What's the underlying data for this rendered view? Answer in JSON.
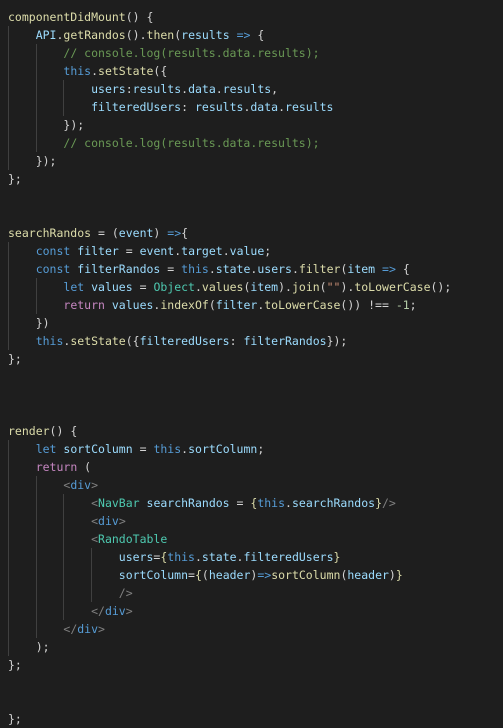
{
  "editor": {
    "language": "javascript-react",
    "theme": "dark-plus",
    "background_color": "#1e1e1e",
    "default_text_color": "#d4d4d4",
    "indent_guide_color": "#404040",
    "font_size_px": 11.5,
    "line_height_px": 18,
    "token_colors": {
      "function": "#dcdcaa",
      "variable": "#9cdcfe",
      "keyword": "#569cd6",
      "control": "#c586c0",
      "class": "#4ec9b0",
      "comment": "#6a9955",
      "number": "#b5cea8",
      "string": "#ce9178",
      "punctuation": "#808080",
      "plain": "#d4d4d4"
    }
  },
  "code": {
    "plain_text": "componentDidMount() {\n    API.getRandos().then(results => {\n        // console.log(results.data.results);\n        this.setState({\n            users:results.data.results,\n            filteredUsers: results.data.results\n        });\n        // console.log(results.data.results);\n    });\n};\n\n\nsearchRandos = (event) =>{\n    const filter = event.target.value;\n    const filterRandos = this.state.users.filter(item => {\n        let values = Object.values(item).join(\"\").toLowerCase();\n        return values.indexOf(filter.toLowerCase()) !== -1;\n    })\n    this.setState({filteredUsers: filterRandos});\n};\n\n\n\nrender() {\n    let sortColumn = this.sortColumn;\n    return (\n        <div>\n            <NavBar searchRandos = {this.searchRandos}/>\n            <div>\n            <RandoTable\n                users={this.state.filteredUsers}\n                sortColumn={(header)=>sortColumn(header)}\n                />\n            </div>\n        </div>\n    );\n};\n\n\n};",
    "lines": [
      {
        "indent": 0,
        "guides": [],
        "tokens": [
          {
            "c": "t-func",
            "t": "componentDidMount"
          },
          {
            "c": "t-brace",
            "t": "() {"
          }
        ]
      },
      {
        "indent": 1,
        "guides": [
          0
        ],
        "tokens": [
          {
            "c": "t-var",
            "t": "API"
          },
          {
            "c": "t-brace",
            "t": "."
          },
          {
            "c": "t-func",
            "t": "getRandos"
          },
          {
            "c": "t-brace",
            "t": "()."
          },
          {
            "c": "t-func",
            "t": "then"
          },
          {
            "c": "t-brace",
            "t": "("
          },
          {
            "c": "t-var",
            "t": "results"
          },
          {
            "c": "t-brace",
            "t": " "
          },
          {
            "c": "t-key",
            "t": "=>"
          },
          {
            "c": "t-brace",
            "t": " {"
          }
        ]
      },
      {
        "indent": 2,
        "guides": [
          0,
          1
        ],
        "tokens": [
          {
            "c": "t-comment",
            "t": "// console.log(results.data.results);"
          }
        ]
      },
      {
        "indent": 2,
        "guides": [
          0,
          1
        ],
        "tokens": [
          {
            "c": "t-key",
            "t": "this"
          },
          {
            "c": "t-brace",
            "t": "."
          },
          {
            "c": "t-func",
            "t": "setState"
          },
          {
            "c": "t-brace",
            "t": "({"
          }
        ]
      },
      {
        "indent": 3,
        "guides": [
          0,
          1,
          2
        ],
        "tokens": [
          {
            "c": "t-var",
            "t": "users"
          },
          {
            "c": "t-brace",
            "t": ":"
          },
          {
            "c": "t-var",
            "t": "results"
          },
          {
            "c": "t-brace",
            "t": "."
          },
          {
            "c": "t-var",
            "t": "data"
          },
          {
            "c": "t-brace",
            "t": "."
          },
          {
            "c": "t-var",
            "t": "results"
          },
          {
            "c": "t-brace",
            "t": ","
          }
        ]
      },
      {
        "indent": 3,
        "guides": [
          0,
          1,
          2
        ],
        "tokens": [
          {
            "c": "t-var",
            "t": "filteredUsers"
          },
          {
            "c": "t-brace",
            "t": ": "
          },
          {
            "c": "t-var",
            "t": "results"
          },
          {
            "c": "t-brace",
            "t": "."
          },
          {
            "c": "t-var",
            "t": "data"
          },
          {
            "c": "t-brace",
            "t": "."
          },
          {
            "c": "t-var",
            "t": "results"
          }
        ]
      },
      {
        "indent": 2,
        "guides": [
          0,
          1
        ],
        "tokens": [
          {
            "c": "t-brace",
            "t": "});"
          }
        ]
      },
      {
        "indent": 2,
        "guides": [
          0,
          1
        ],
        "tokens": [
          {
            "c": "t-comment",
            "t": "// console.log(results.data.results);"
          }
        ]
      },
      {
        "indent": 1,
        "guides": [
          0
        ],
        "tokens": [
          {
            "c": "t-brace",
            "t": "});"
          }
        ]
      },
      {
        "indent": 0,
        "guides": [],
        "tokens": [
          {
            "c": "t-brace",
            "t": "};"
          }
        ]
      },
      {
        "indent": 0,
        "guides": [],
        "tokens": []
      },
      {
        "indent": 0,
        "guides": [],
        "tokens": []
      },
      {
        "indent": 0,
        "guides": [],
        "tokens": [
          {
            "c": "t-func",
            "t": "searchRandos"
          },
          {
            "c": "t-brace",
            "t": " = ("
          },
          {
            "c": "t-var",
            "t": "event"
          },
          {
            "c": "t-brace",
            "t": ") "
          },
          {
            "c": "t-key",
            "t": "=>"
          },
          {
            "c": "t-brace",
            "t": "{"
          }
        ]
      },
      {
        "indent": 1,
        "guides": [
          0
        ],
        "tokens": [
          {
            "c": "t-key",
            "t": "const"
          },
          {
            "c": "t-brace",
            "t": " "
          },
          {
            "c": "t-var",
            "t": "filter"
          },
          {
            "c": "t-brace",
            "t": " = "
          },
          {
            "c": "t-var",
            "t": "event"
          },
          {
            "c": "t-brace",
            "t": "."
          },
          {
            "c": "t-var",
            "t": "target"
          },
          {
            "c": "t-brace",
            "t": "."
          },
          {
            "c": "t-var",
            "t": "value"
          },
          {
            "c": "t-brace",
            "t": ";"
          }
        ]
      },
      {
        "indent": 1,
        "guides": [
          0
        ],
        "tokens": [
          {
            "c": "t-key",
            "t": "const"
          },
          {
            "c": "t-brace",
            "t": " "
          },
          {
            "c": "t-var",
            "t": "filterRandos"
          },
          {
            "c": "t-brace",
            "t": " = "
          },
          {
            "c": "t-key",
            "t": "this"
          },
          {
            "c": "t-brace",
            "t": "."
          },
          {
            "c": "t-var",
            "t": "state"
          },
          {
            "c": "t-brace",
            "t": "."
          },
          {
            "c": "t-var",
            "t": "users"
          },
          {
            "c": "t-brace",
            "t": "."
          },
          {
            "c": "t-func",
            "t": "filter"
          },
          {
            "c": "t-brace",
            "t": "("
          },
          {
            "c": "t-var",
            "t": "item"
          },
          {
            "c": "t-brace",
            "t": " "
          },
          {
            "c": "t-key",
            "t": "=>"
          },
          {
            "c": "t-brace",
            "t": " {"
          }
        ]
      },
      {
        "indent": 2,
        "guides": [
          0,
          1
        ],
        "tokens": [
          {
            "c": "t-key",
            "t": "let"
          },
          {
            "c": "t-brace",
            "t": " "
          },
          {
            "c": "t-var",
            "t": "values"
          },
          {
            "c": "t-brace",
            "t": " = "
          },
          {
            "c": "t-class",
            "t": "Object"
          },
          {
            "c": "t-brace",
            "t": "."
          },
          {
            "c": "t-func",
            "t": "values"
          },
          {
            "c": "t-brace",
            "t": "("
          },
          {
            "c": "t-var",
            "t": "item"
          },
          {
            "c": "t-brace",
            "t": ")."
          },
          {
            "c": "t-func",
            "t": "join"
          },
          {
            "c": "t-brace",
            "t": "("
          },
          {
            "c": "t-str",
            "t": "\"\""
          },
          {
            "c": "t-brace",
            "t": ")."
          },
          {
            "c": "t-func",
            "t": "toLowerCase"
          },
          {
            "c": "t-brace",
            "t": "();"
          }
        ]
      },
      {
        "indent": 2,
        "guides": [
          0,
          1
        ],
        "tokens": [
          {
            "c": "t-ctrl",
            "t": "return"
          },
          {
            "c": "t-brace",
            "t": " "
          },
          {
            "c": "t-var",
            "t": "values"
          },
          {
            "c": "t-brace",
            "t": "."
          },
          {
            "c": "t-func",
            "t": "indexOf"
          },
          {
            "c": "t-brace",
            "t": "("
          },
          {
            "c": "t-var",
            "t": "filter"
          },
          {
            "c": "t-brace",
            "t": "."
          },
          {
            "c": "t-func",
            "t": "toLowerCase"
          },
          {
            "c": "t-brace",
            "t": "()) !== "
          },
          {
            "c": "t-num",
            "t": "-1"
          },
          {
            "c": "t-brace",
            "t": ";"
          }
        ]
      },
      {
        "indent": 1,
        "guides": [
          0
        ],
        "tokens": [
          {
            "c": "t-brace",
            "t": "})"
          }
        ]
      },
      {
        "indent": 1,
        "guides": [
          0
        ],
        "tokens": [
          {
            "c": "t-key",
            "t": "this"
          },
          {
            "c": "t-brace",
            "t": "."
          },
          {
            "c": "t-func",
            "t": "setState"
          },
          {
            "c": "t-brace",
            "t": "({"
          },
          {
            "c": "t-var",
            "t": "filteredUsers"
          },
          {
            "c": "t-brace",
            "t": ": "
          },
          {
            "c": "t-var",
            "t": "filterRandos"
          },
          {
            "c": "t-brace",
            "t": "});"
          }
        ]
      },
      {
        "indent": 0,
        "guides": [],
        "tokens": [
          {
            "c": "t-brace",
            "t": "};"
          }
        ]
      },
      {
        "indent": 0,
        "guides": [],
        "tokens": []
      },
      {
        "indent": 0,
        "guides": [],
        "tokens": []
      },
      {
        "indent": 0,
        "guides": [],
        "tokens": []
      },
      {
        "indent": 0,
        "guides": [],
        "tokens": [
          {
            "c": "t-func",
            "t": "render"
          },
          {
            "c": "t-brace",
            "t": "() {"
          }
        ]
      },
      {
        "indent": 1,
        "guides": [
          0
        ],
        "tokens": [
          {
            "c": "t-key",
            "t": "let"
          },
          {
            "c": "t-brace",
            "t": " "
          },
          {
            "c": "t-var",
            "t": "sortColumn"
          },
          {
            "c": "t-brace",
            "t": " = "
          },
          {
            "c": "t-key",
            "t": "this"
          },
          {
            "c": "t-brace",
            "t": "."
          },
          {
            "c": "t-var",
            "t": "sortColumn"
          },
          {
            "c": "t-brace",
            "t": ";"
          }
        ]
      },
      {
        "indent": 1,
        "guides": [
          0
        ],
        "tokens": [
          {
            "c": "t-ctrl",
            "t": "return"
          },
          {
            "c": "t-brace",
            "t": " ("
          }
        ]
      },
      {
        "indent": 2,
        "guides": [
          0,
          1
        ],
        "tokens": [
          {
            "c": "t-punct",
            "t": "<"
          },
          {
            "c": "t-tag",
            "t": "div"
          },
          {
            "c": "t-punct",
            "t": ">"
          }
        ]
      },
      {
        "indent": 3,
        "guides": [
          0,
          1,
          2
        ],
        "tokens": [
          {
            "c": "t-punct",
            "t": "<"
          },
          {
            "c": "t-class",
            "t": "NavBar"
          },
          {
            "c": "t-brace",
            "t": " "
          },
          {
            "c": "t-var",
            "t": "searchRandos"
          },
          {
            "c": "t-brace",
            "t": " = "
          },
          {
            "c": "t-func",
            "t": "{"
          },
          {
            "c": "t-key",
            "t": "this"
          },
          {
            "c": "t-brace",
            "t": "."
          },
          {
            "c": "t-var",
            "t": "searchRandos"
          },
          {
            "c": "t-func",
            "t": "}"
          },
          {
            "c": "t-punct",
            "t": "/>"
          }
        ]
      },
      {
        "indent": 3,
        "guides": [
          0,
          1,
          2
        ],
        "tokens": [
          {
            "c": "t-punct",
            "t": "<"
          },
          {
            "c": "t-tag",
            "t": "div"
          },
          {
            "c": "t-punct",
            "t": ">"
          }
        ]
      },
      {
        "indent": 3,
        "guides": [
          0,
          1,
          2
        ],
        "tokens": [
          {
            "c": "t-punct",
            "t": "<"
          },
          {
            "c": "t-class",
            "t": "RandoTable"
          }
        ]
      },
      {
        "indent": 4,
        "guides": [
          0,
          1,
          2,
          3
        ],
        "tokens": [
          {
            "c": "t-var",
            "t": "users"
          },
          {
            "c": "t-brace",
            "t": "="
          },
          {
            "c": "t-func",
            "t": "{"
          },
          {
            "c": "t-key",
            "t": "this"
          },
          {
            "c": "t-brace",
            "t": "."
          },
          {
            "c": "t-var",
            "t": "state"
          },
          {
            "c": "t-brace",
            "t": "."
          },
          {
            "c": "t-var",
            "t": "filteredUsers"
          },
          {
            "c": "t-func",
            "t": "}"
          }
        ]
      },
      {
        "indent": 4,
        "guides": [
          0,
          1,
          2,
          3
        ],
        "tokens": [
          {
            "c": "t-var",
            "t": "sortColumn"
          },
          {
            "c": "t-brace",
            "t": "="
          },
          {
            "c": "t-func",
            "t": "{"
          },
          {
            "c": "t-brace",
            "t": "("
          },
          {
            "c": "t-var",
            "t": "header"
          },
          {
            "c": "t-brace",
            "t": ")"
          },
          {
            "c": "t-key",
            "t": "=>"
          },
          {
            "c": "t-func",
            "t": "sortColumn"
          },
          {
            "c": "t-brace",
            "t": "("
          },
          {
            "c": "t-var",
            "t": "header"
          },
          {
            "c": "t-brace",
            "t": ")"
          },
          {
            "c": "t-func",
            "t": "}"
          }
        ]
      },
      {
        "indent": 4,
        "guides": [
          0,
          1,
          2,
          3
        ],
        "tokens": [
          {
            "c": "t-punct",
            "t": "/>"
          }
        ]
      },
      {
        "indent": 3,
        "guides": [
          0,
          1,
          2
        ],
        "tokens": [
          {
            "c": "t-punct",
            "t": "</"
          },
          {
            "c": "t-tag",
            "t": "div"
          },
          {
            "c": "t-punct",
            "t": ">"
          }
        ]
      },
      {
        "indent": 2,
        "guides": [
          0,
          1
        ],
        "tokens": [
          {
            "c": "t-punct",
            "t": "</"
          },
          {
            "c": "t-tag",
            "t": "div"
          },
          {
            "c": "t-punct",
            "t": ">"
          }
        ]
      },
      {
        "indent": 1,
        "guides": [
          0
        ],
        "tokens": [
          {
            "c": "t-brace",
            "t": ");"
          }
        ]
      },
      {
        "indent": 0,
        "guides": [],
        "tokens": [
          {
            "c": "t-brace",
            "t": "};"
          }
        ]
      },
      {
        "indent": 0,
        "guides": [],
        "tokens": []
      },
      {
        "indent": 0,
        "guides": [],
        "tokens": []
      },
      {
        "indent": 0,
        "guides": [],
        "tokens": [
          {
            "c": "t-brace",
            "t": "};"
          }
        ]
      }
    ]
  }
}
